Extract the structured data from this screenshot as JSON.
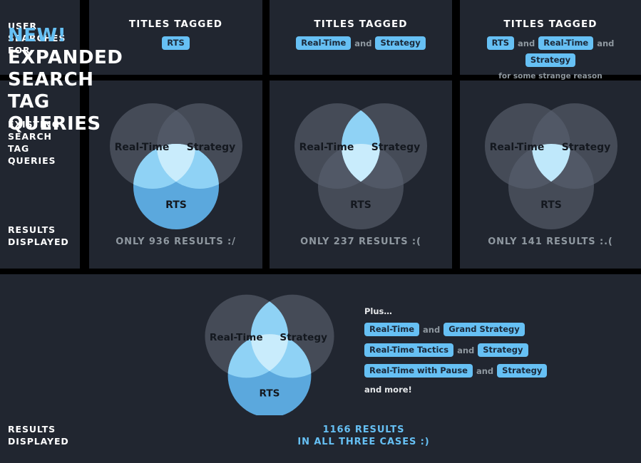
{
  "theme": {
    "page_bg": "#000000",
    "panel_bg": "#212630",
    "accent": "#66c0f4",
    "muted_text": "#8f98a0",
    "white_text": "#ffffff",
    "venn_gray": "#3d434e",
    "venn_blue": "#5ba8dd",
    "venn_blue_light": "#8fd2f5",
    "venn_blue_lightest": "#bfe8fb",
    "tag_text": "#1b2838"
  },
  "row_labels": {
    "user_searches_for": "User\nSearches\nFor",
    "existing_search_tag_queries": "Existing\nSearch\nTag\nQueries",
    "results_displayed": "Results\nDisplayed"
  },
  "columns": [
    {
      "header": {
        "title": "Titles Tagged",
        "tags": [
          "RTS"
        ],
        "conjunctions": [],
        "note": ""
      },
      "venn": {
        "labels": {
          "left": "Real-Time",
          "right": "Strategy",
          "bottom": "RTS"
        },
        "highlight": "rts-circle"
      },
      "results_caption": "Only 936 Results :/",
      "result_count": 936
    },
    {
      "header": {
        "title": "Titles Tagged",
        "tags": [
          "Real-Time",
          "Strategy"
        ],
        "conjunctions": [
          "and"
        ],
        "note": ""
      },
      "venn": {
        "labels": {
          "left": "Real-Time",
          "right": "Strategy",
          "bottom": "RTS"
        },
        "highlight": "realtime-strategy-lens"
      },
      "results_caption": "Only 237 Results :(",
      "result_count": 237
    },
    {
      "header": {
        "title": "Titles Tagged",
        "tags": [
          "RTS",
          "Real-Time",
          "Strategy"
        ],
        "conjunctions": [
          "and",
          "and"
        ],
        "note": "for some strange reason"
      },
      "venn": {
        "labels": {
          "left": "Real-Time",
          "right": "Strategy",
          "bottom": "RTS"
        },
        "highlight": "triple-intersection"
      },
      "results_caption": "Only 141 Results :.(",
      "result_count": 141
    }
  ],
  "bottom": {
    "headline_lines": [
      "New!",
      "Expanded",
      "Search",
      "Tag",
      "Queries"
    ],
    "accent_line_index": 0,
    "results_label": "Results\nDisplayed",
    "venn": {
      "labels": {
        "left": "Real-Time",
        "right": "Strategy",
        "bottom": "RTS"
      },
      "highlight": "rts-circle-and-realtime-strategy-lens"
    },
    "plus": {
      "title": "Plus…",
      "rows": [
        {
          "tags": [
            "Real-Time",
            "Grand Strategy"
          ],
          "conjunction": "and"
        },
        {
          "tags": [
            "Real-Time Tactics",
            "Strategy"
          ],
          "conjunction": "and"
        },
        {
          "tags": [
            "Real-Time with Pause",
            "Strategy"
          ],
          "conjunction": "and"
        }
      ],
      "more": "and more!"
    },
    "final_results": "1166 Results\nIn All Three Cases :)",
    "final_result_count": 1166
  }
}
